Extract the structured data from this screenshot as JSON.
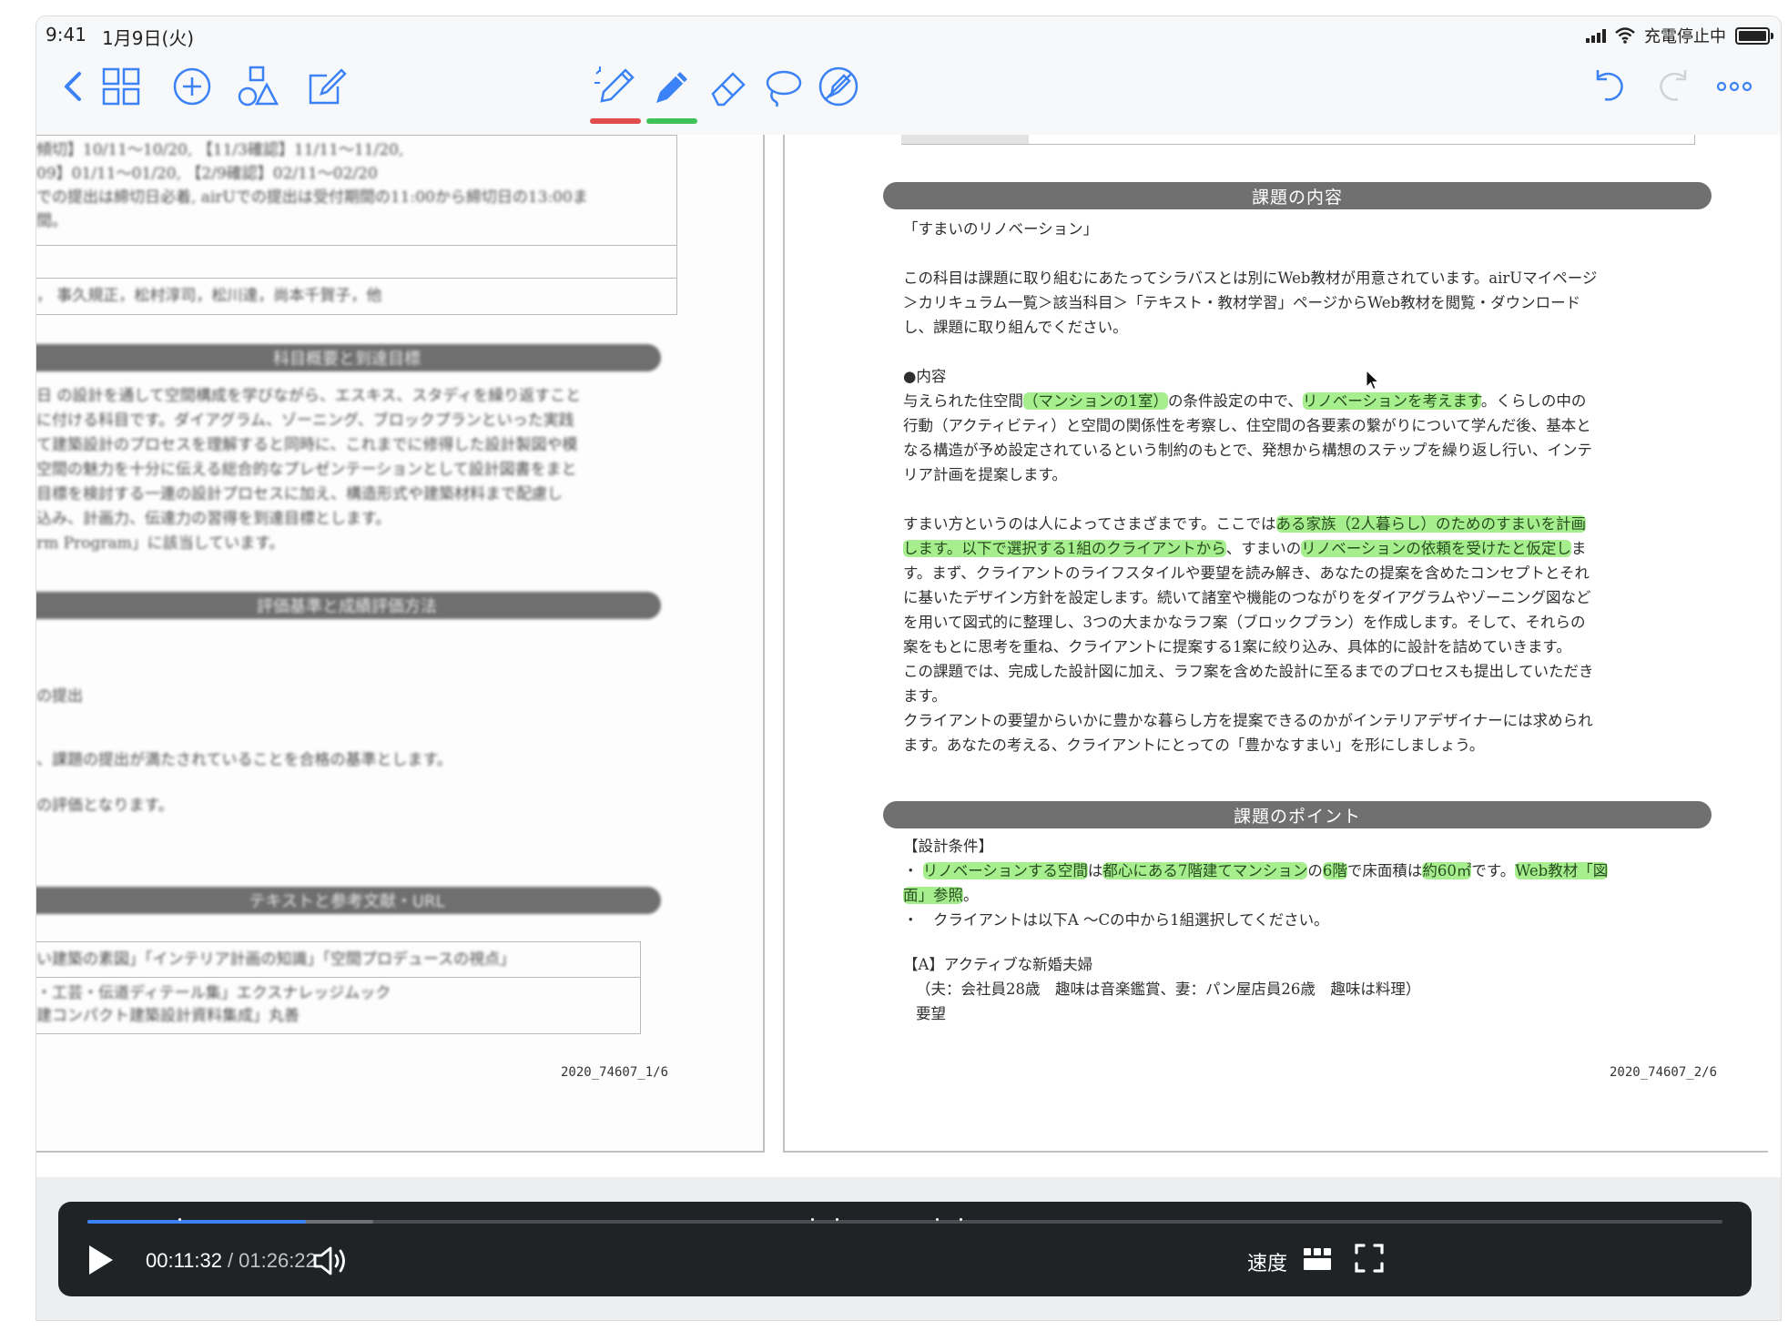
{
  "status_bar": {
    "time": "9:41",
    "date": "1月9日(火)",
    "charging": "充電停止中"
  },
  "toolbar": {
    "icons": [
      "back-chevron-icon",
      "grid-icon",
      "add-circle-icon",
      "shapes-icon",
      "edit-icon",
      "pen-tool-icon",
      "highlighter-icon",
      "eraser-icon",
      "lasso-icon",
      "pointer-off-icon",
      "undo-icon",
      "redo-icon",
      "more-icon"
    ],
    "pen_color": "#e24b4b",
    "highlighter_color": "#3ec35a"
  },
  "left_page": {
    "rows": [
      "傾切】10/11～10/20, 【11/3確認】11/11～11/20,",
      "09】01/11～01/20, 【2/9確認】02/11～02/20",
      "での提出は締切日必着, airUでの提出は受付期間の11:00から締切日の13:00ま",
      "間。"
    ],
    "authors": "， 事久規正，松村淳司，松川達，尚本千賀子，他",
    "section1_title": "科目概要と到達目標",
    "section1_lines": [
      "日 の設計を通して空間構成を学びながら、エスキス、スタディを繰り返すこと",
      "に付ける科目です。ダイアグラム、ゾーニング、ブロックプランといった実践",
      "て建築設計のプロセスを理解すると同時に、これまでに修得した設計製図や模",
      "空間の魅力を十分に伝える総合的なプレゼンテーションとして設計図書をまと",
      "目標を検討する一連の設計プロセスに加え、構造形式や建築材料まで配慮し",
      "込み、計画力、伝達力の習得を到達目標とします。",
      "rm Program」に該当しています。"
    ],
    "section2_title": "評価基準と成績評価方法",
    "section2_lines": [
      "の提出",
      "、課題の提出が満たされていることを合格の基準とします。",
      "の評価となります。"
    ],
    "section3_title": "テキストと参考文献・URL",
    "section3_lines": [
      "い建築の素図」「インテリア計画の知識」「空間プロデュースの視点」",
      "・工芸・伝道ディテール集」エクスナレッジムック",
      "建コンパクト建築設計資料集成」丸善"
    ],
    "page_number": "2020_74607_1/6"
  },
  "right_page": {
    "section_content_title": "課題の内容",
    "subject_title": "「すまいのリノベーション」",
    "intro_lines": [
      "この科目は課題に取り組むにあたってシラバスとは別にWeb教材が用意されています。airUマイページ",
      "＞カリキュラム一覧＞該当科目＞「テキスト・教材学習」ページからWeb教材を閲覧・ダウンロード",
      "し、課題に取り組んでください。"
    ],
    "content_heading": "●内容",
    "content_lines": {
      "l1_a": "与えられた住空間",
      "l1_hl1": "（マンションの1室）",
      "l1_b": "の条件設定の中で、",
      "l1_hl2": "リノベーションを考えます",
      "l1_c": "。くらしの中の",
      "l2": "行動（アクティビティ）と空間の関係性を考察し、住空間の各要素の繋がりについて学んだ後、基本と",
      "l3": "なる構造が予め設定されているという制約のもとで、発想から構想のステップを繰り返し行い、インテ",
      "l4": "リア計画を提案します。"
    },
    "para2": {
      "l1_a": "すまい方というのは人によってさまざまです。ここでは",
      "l1_hl": "ある家族（2人暮らし）のためのすまいを計画",
      "l2_hl1": "します。以下で選択する1組のクライアントから",
      "l2_b": "、すまいの",
      "l2_hl2": "リノベーションの依頼を受けたと仮定し",
      "l2_c": "ま",
      "l3": "す。まず、クライアントのライフスタイルや要望を読み解き、あなたの提案を含めたコンセプトとそれ",
      "l4": "に基いたデザイン方針を設定します。続いて諸室や機能のつながりをダイアグラムやゾーニング図など",
      "l5": "を用いて図式的に整理し、3つの大まかなラフ案（ブロックプラン）を作成します。そして、それらの",
      "l6": "案をもとに思考を重ね、クライアントに提案する1案に絞り込み、具体的に設計を詰めていきます。",
      "l7": "この課題では、完成した設計図に加え、ラフ案を含めた設計に至るまでのプロセスも提出していただき",
      "l8": "ます。",
      "l9": "クライアントの要望からいかに豊かな暮らし方を提案できるのかがインテリアデザイナーには求められ",
      "l10": "ます。あなたの考える、クライアントにとっての「豊かなすまい」を形にしましょう。"
    },
    "section_points_title": "課題のポイント",
    "design_conditions_heading": "【設計条件】",
    "points": {
      "p1_bullet": "・",
      "p1_hl1": "リノベーションする空間",
      "p1_a": "は",
      "p1_hl2": "都心にある7階建てマンション",
      "p1_b": "の",
      "p1_hl3": "6階",
      "p1_c": "で床面積は",
      "p1_hl4": "約60㎡",
      "p1_d": "です。",
      "p1_hl5": "Web教材「図",
      "p1_line2_hl": "面」参照",
      "p1_line2_b": "。",
      "p2": "・　クライアントは以下A ～Cの中から1組選択してください。"
    },
    "client_a_title": "【A】アクティブな新婚夫婦",
    "client_a_detail": "（夫：会社員28歳　趣味は音楽鑑賞、妻：パン屋店員26歳　趣味は料理）",
    "client_a_request": "要望",
    "page_number": "2020_74607_2/6"
  },
  "video": {
    "current_time": "00:11:32",
    "separator": "/",
    "duration": "01:26:22",
    "progress_fraction": 0.1335,
    "buffered_fraction": 0.175,
    "speed_label": "速度",
    "accent": "#3b82f6"
  }
}
